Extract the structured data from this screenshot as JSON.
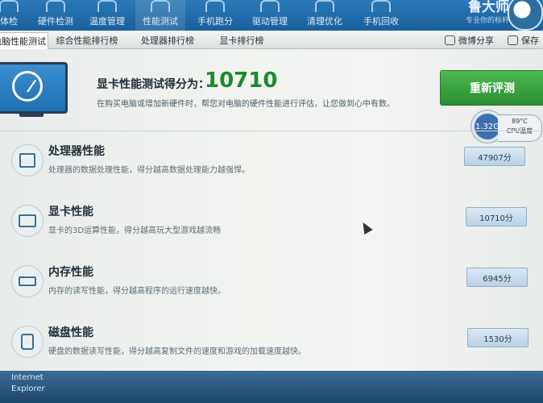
{
  "toolbar": {
    "items": [
      {
        "label": "体检"
      },
      {
        "label": "硬件检测"
      },
      {
        "label": "温度管理"
      },
      {
        "label": "性能测试"
      },
      {
        "label": "手机跑分"
      },
      {
        "label": "驱动管理"
      },
      {
        "label": "清理优化"
      },
      {
        "label": "手机回收"
      }
    ],
    "brand_name": "鲁大师",
    "brand_sub": "专业你的标杆"
  },
  "tabs": {
    "items": [
      {
        "label": "电脑性能测试"
      },
      {
        "label": "综合性能排行榜"
      },
      {
        "label": "处理器排行榜"
      },
      {
        "label": "显卡排行榜"
      }
    ],
    "share_label": "微博分享",
    "save_label": "保存"
  },
  "main": {
    "score_label": "显卡性能测试得分为：",
    "score_value": "10710",
    "score_desc": "在购买电脑或增加新硬件时，帮您对电脑的硬件性能进行评估，让您做到心中有数。",
    "retest_label": "重新评测",
    "cpu_usage": "1.32G",
    "cpu_temp": "89°C",
    "cpu_temp_label": "CPU温度"
  },
  "perf": [
    {
      "title": "处理器性能",
      "desc": "处理器的数据处理性能，得分越高数据处理能力越强悍。",
      "score": "47907分",
      "icon": "cpu-icon"
    },
    {
      "title": "显卡性能",
      "desc": "显卡的3D运算性能，得分越高玩大型游戏越流畅",
      "score": "10710分",
      "icon": "graphics-card-icon"
    },
    {
      "title": "内存性能",
      "desc": "内存的读写性能，得分越高程序的运行速度越快。",
      "score": "6945分",
      "icon": "memory-icon"
    },
    {
      "title": "磁盘性能",
      "desc": "硬盘的数据读写性能，得分越高复制文件的速度和游戏的加载速度越快。",
      "score": "1530分",
      "icon": "disk-icon"
    }
  ],
  "taskbar": {
    "ie_label_1": "Internet",
    "ie_label_2": "Explorer"
  },
  "colors": {
    "toolbar_bg": "#1f68a6",
    "score_green": "#1d8a2d",
    "retest_green": "#2f9a36"
  }
}
